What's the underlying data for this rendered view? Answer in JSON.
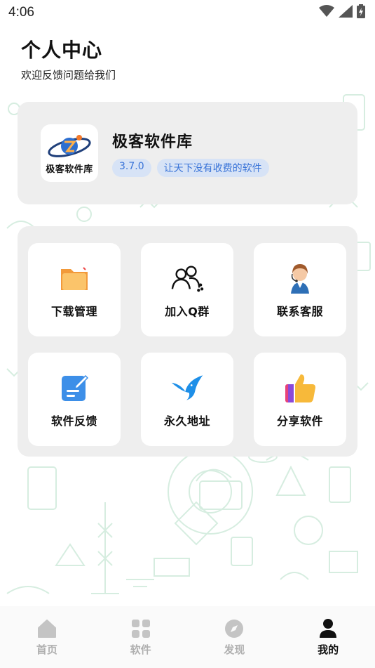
{
  "status_bar": {
    "time": "4:06"
  },
  "header": {
    "title": "个人中心",
    "subtitle": "欢迎反馈问题给我们"
  },
  "profile": {
    "logo_text": "极客软件库",
    "app_name": "极客软件库",
    "version": "3.7.0",
    "slogan": "让天下没有收费的软件"
  },
  "tiles": [
    {
      "label": "下载管理",
      "icon": "folder-icon"
    },
    {
      "label": "加入Q群",
      "icon": "group-icon"
    },
    {
      "label": "联系客服",
      "icon": "customer-service-icon"
    },
    {
      "label": "软件反馈",
      "icon": "feedback-edit-icon"
    },
    {
      "label": "永久地址",
      "icon": "bird-icon"
    },
    {
      "label": "分享软件",
      "icon": "thumbs-up-icon"
    }
  ],
  "bottom_nav": [
    {
      "label": "首页",
      "icon": "home-icon",
      "active": false
    },
    {
      "label": "软件",
      "icon": "apps-grid-icon",
      "active": false
    },
    {
      "label": "发现",
      "icon": "compass-icon",
      "active": false
    },
    {
      "label": "我的",
      "icon": "user-icon",
      "active": true
    }
  ],
  "colors": {
    "accent": "#3a74d8",
    "badge_bg": "#d7e3f6",
    "card_bg": "#eeeeee",
    "doodle": "#d6ede0"
  }
}
